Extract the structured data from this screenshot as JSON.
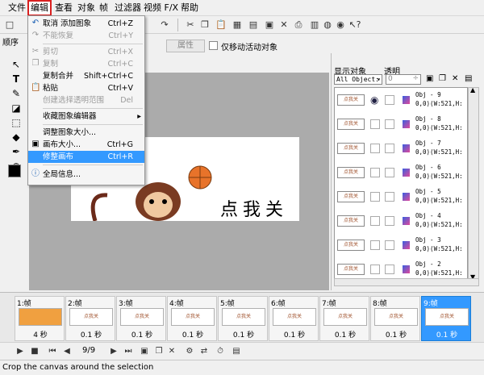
{
  "menubar": {
    "items": [
      "文件",
      "编辑",
      "查看",
      "对象",
      "帧",
      "过滤器",
      "视频 F/X",
      "帮助"
    ]
  },
  "toolbar": {
    "property_label": "属性",
    "move_active_only": "仅移动活动对象"
  },
  "left_panel": {
    "order_label": "顺序"
  },
  "edit_menu": {
    "items": [
      {
        "label": "取消 添加图象",
        "shortcut": "Ctrl+Z",
        "disabled": false,
        "icon": "undo-icon"
      },
      {
        "label": "不能恢复",
        "shortcut": "Ctrl+Y",
        "disabled": true,
        "icon": "redo-icon"
      },
      {
        "label": "剪切",
        "shortcut": "Ctrl+X",
        "disabled": true,
        "icon": "cut-icon"
      },
      {
        "label": "复制",
        "shortcut": "Ctrl+C",
        "disabled": true,
        "icon": "copy-icon"
      },
      {
        "label": "复制合并",
        "shortcut": "Shift+Ctrl+C",
        "disabled": false,
        "icon": ""
      },
      {
        "label": "粘贴",
        "shortcut": "Ctrl+V",
        "disabled": false,
        "icon": "paste-icon"
      },
      {
        "label": "创建选择透明范围",
        "shortcut": "Del",
        "disabled": true,
        "icon": ""
      },
      {
        "label": "收藏图象编辑器",
        "shortcut": "",
        "disabled": false,
        "icon": "",
        "submenu": true
      },
      {
        "label": "调整图象大小...",
        "shortcut": "",
        "disabled": false,
        "icon": ""
      },
      {
        "label": "画布大小...",
        "shortcut": "Ctrl+G",
        "disabled": false,
        "icon": "canvas-size-icon"
      },
      {
        "label": "修整画布",
        "shortcut": "Ctrl+R",
        "disabled": false,
        "icon": "",
        "highlight": true
      },
      {
        "label": "全局信息...",
        "shortcut": "",
        "disabled": false,
        "icon": "info-icon"
      }
    ]
  },
  "canvas_text": "点我关",
  "object_panel": {
    "show_objects_label": "显示对象",
    "transparency_label": "透明",
    "filter_value": "All Object:",
    "transparency_value": "0",
    "objects": [
      {
        "name": "Obj - 9",
        "info": "0,0)(W:521,H:"
      },
      {
        "name": "Obj - 8",
        "info": "0,0)(W:521,H:"
      },
      {
        "name": "Obj - 7",
        "info": "0,0)(W:521,H:"
      },
      {
        "name": "Obj - 6",
        "info": "0,0)(W:521,H:"
      },
      {
        "name": "Obj - 5",
        "info": "0,0)(W:521,H:"
      },
      {
        "name": "Obj - 4",
        "info": "0,0)(W:521,H:"
      },
      {
        "name": "Obj - 3",
        "info": "0,0)(W:521,H:"
      },
      {
        "name": "Obj - 2",
        "info": "0,0)(W:521,H:"
      }
    ]
  },
  "frames": [
    {
      "label": "1:帧",
      "duration": "4 秒"
    },
    {
      "label": "2:帧",
      "duration": "0.1 秒"
    },
    {
      "label": "3:帧",
      "duration": "0.1 秒"
    },
    {
      "label": "4:帧",
      "duration": "0.1 秒"
    },
    {
      "label": "5:帧",
      "duration": "0.1 秒"
    },
    {
      "label": "6:帧",
      "duration": "0.1 秒"
    },
    {
      "label": "7:帧",
      "duration": "0.1 秒"
    },
    {
      "label": "8:帧",
      "duration": "0.1 秒"
    },
    {
      "label": "9:帧",
      "duration": "0.1 秒",
      "selected": true
    }
  ],
  "playback": {
    "frame_counter": "9/9"
  },
  "status_text": "Crop the canvas around the selection",
  "colors": {
    "highlight": "#3399ff",
    "annotation": "#d92020"
  }
}
